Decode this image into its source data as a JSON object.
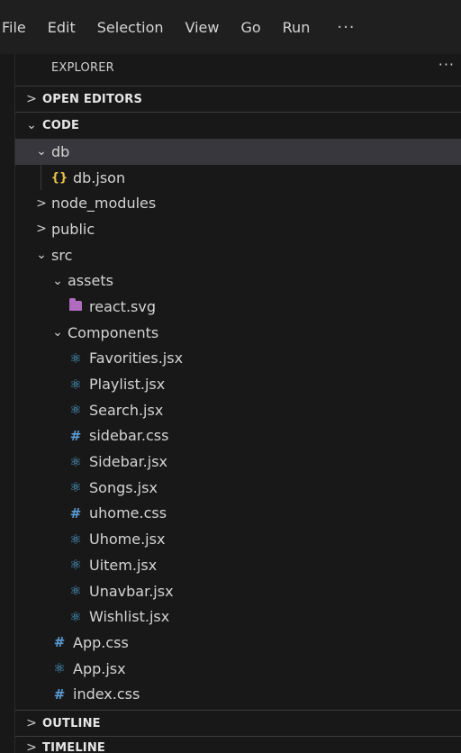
{
  "menubar": {
    "items": [
      "File",
      "Edit",
      "Selection",
      "View",
      "Go",
      "Run"
    ],
    "more": "···"
  },
  "explorer": {
    "title": "EXPLORER",
    "more": "···"
  },
  "sections": {
    "open_editors": "OPEN EDITORS",
    "code": "CODE",
    "outline": "OUTLINE",
    "timeline": "TIMELINE"
  },
  "tree": {
    "db": "db",
    "db_json": "db.json",
    "node_modules": "node_modules",
    "public": "public",
    "src": "src",
    "assets": "assets",
    "react_svg": "react.svg",
    "components": "Components",
    "favorities": "Favorities.jsx",
    "playlist": "Playlist.jsx",
    "search": "Search.jsx",
    "sidebar_css": "sidebar.css",
    "sidebar_jsx": "Sidebar.jsx",
    "songs": "Songs.jsx",
    "uhome_css": "uhome.css",
    "uhome_jsx": "Uhome.jsx",
    "uitem": "Uitem.jsx",
    "unavbar": "Unavbar.jsx",
    "wishlist": "Wishlist.jsx",
    "app_css": "App.css",
    "app_jsx": "App.jsx",
    "index_css": "index.css"
  },
  "icons": {
    "chevron_right": "›",
    "chevron_down": "⌄",
    "json": "{}",
    "react": "⚛",
    "css": "#"
  },
  "colors": {
    "background": "#181818",
    "selected_row": "#37373d",
    "json_icon": "#e6c34a",
    "react_icon": "#4fa8d8",
    "css_icon": "#5b9bd5",
    "svg_icon": "#b06bc0"
  }
}
